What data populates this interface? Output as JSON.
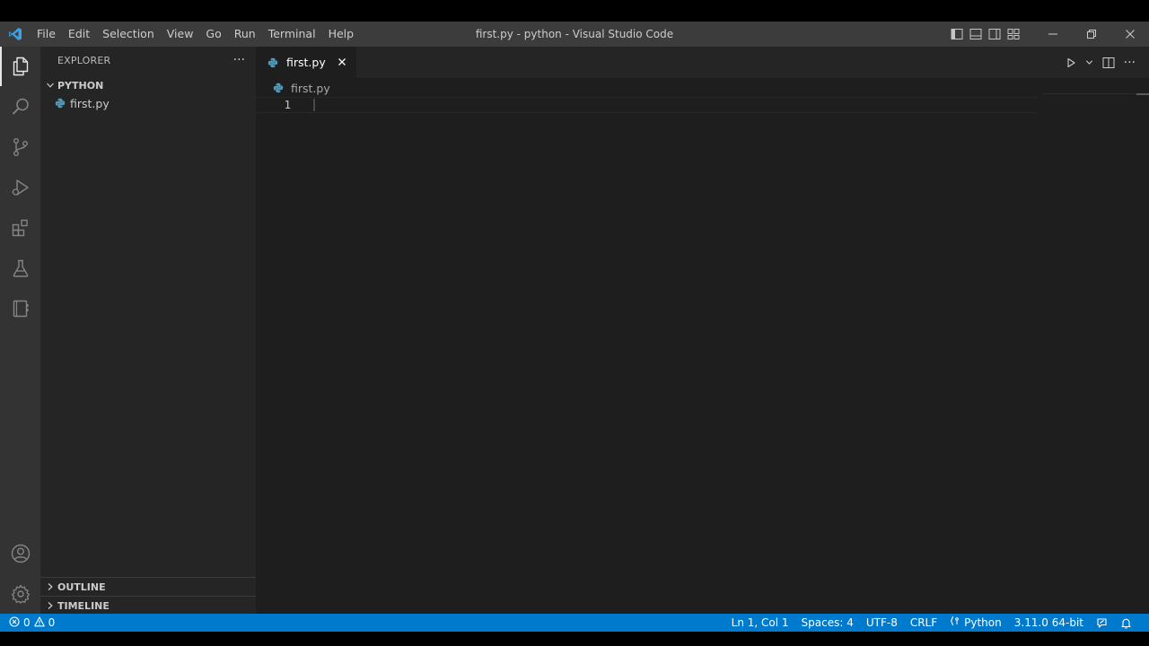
{
  "titlebar": {
    "menu": [
      "File",
      "Edit",
      "Selection",
      "View",
      "Go",
      "Run",
      "Terminal",
      "Help"
    ],
    "window_title": "first.py - python - Visual Studio Code"
  },
  "activitybar": {
    "items": [
      "explorer-icon",
      "search-icon",
      "source-control-icon",
      "run-debug-icon",
      "extensions-icon",
      "testing-icon",
      "notebook-icon"
    ],
    "bottom": [
      "accounts-icon",
      "settings-gear-icon"
    ]
  },
  "sidebar": {
    "title": "EXPLORER",
    "more": "···",
    "folder": "PYTHON",
    "files": [
      "first.py"
    ],
    "sections": [
      "OUTLINE",
      "TIMELINE"
    ]
  },
  "editor": {
    "tab_label": "first.py",
    "breadcrumb": "first.py",
    "line_numbers": [
      "1"
    ],
    "more": "···"
  },
  "statusbar": {
    "errors": "0",
    "warnings": "0",
    "position": "Ln 1, Col 1",
    "indent": "Spaces: 4",
    "encoding": "UTF-8",
    "eol": "CRLF",
    "language": "Python",
    "interpreter": "3.11.0 64-bit"
  },
  "colors": {
    "accent": "#007acc",
    "titlebar": "#3c3c3c",
    "activitybar": "#333333",
    "sidebar": "#252526",
    "editor": "#1e1e1e",
    "python_icon": "#519aba"
  }
}
